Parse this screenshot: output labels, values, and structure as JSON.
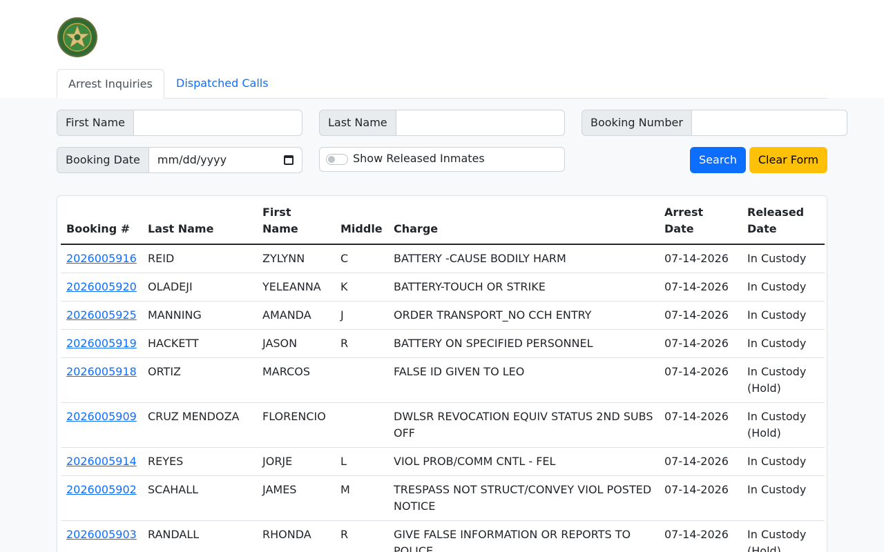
{
  "tabs": [
    {
      "label": "Arrest Inquiries",
      "active": true
    },
    {
      "label": "Dispatched Calls",
      "active": false
    }
  ],
  "form": {
    "first_name_label": "First Name",
    "first_name_value": "",
    "last_name_label": "Last Name",
    "last_name_value": "",
    "booking_number_label": "Booking Number",
    "booking_number_value": "",
    "booking_date_label": "Booking Date",
    "booking_date_placeholder": "mm/dd/yyyy",
    "show_released_label": "Show Released Inmates",
    "show_released_checked": false,
    "search_label": "Search",
    "clear_label": "Clear Form"
  },
  "table": {
    "headers": {
      "booking": "Booking #",
      "last": "Last Name",
      "first_line1": "First",
      "first_line2": "Name",
      "middle": "Middle",
      "charge": "Charge",
      "arrest_line1": "Arrest",
      "arrest_line2": "Date",
      "released_line1": "Released",
      "released_line2": "Date"
    },
    "rows": [
      {
        "booking": "2026005916",
        "last": "REID",
        "first": "ZYLYNN",
        "middle": "C",
        "charge": "BATTERY -CAUSE BODILY HARM",
        "arrest": "07-14-2026",
        "released": "In Custody"
      },
      {
        "booking": "2026005920",
        "last": "OLADEJI",
        "first": "YELEANNA",
        "middle": "K",
        "charge": "BATTERY-TOUCH OR STRIKE",
        "arrest": "07-14-2026",
        "released": "In Custody"
      },
      {
        "booking": "2026005925",
        "last": "MANNING",
        "first": "AMANDA",
        "middle": "J",
        "charge": "ORDER TRANSPORT_NO CCH ENTRY",
        "arrest": "07-14-2026",
        "released": "In Custody"
      },
      {
        "booking": "2026005919",
        "last": "HACKETT",
        "first": "JASON",
        "middle": "R",
        "charge": "BATTERY ON SPECIFIED PERSONNEL",
        "arrest": "07-14-2026",
        "released": "In Custody"
      },
      {
        "booking": "2026005918",
        "last": "ORTIZ",
        "first": "MARCOS",
        "middle": "",
        "charge": "FALSE ID GIVEN TO LEO",
        "arrest": "07-14-2026",
        "released": "In Custody (Hold)"
      },
      {
        "booking": "2026005909",
        "last": "CRUZ MENDOZA",
        "first": "FLORENCIO",
        "middle": "",
        "charge": "DWLSR REVOCATION EQUIV STATUS 2ND SUBS OFF",
        "arrest": "07-14-2026",
        "released": "In Custody (Hold)"
      },
      {
        "booking": "2026005914",
        "last": "REYES",
        "first": "JORJE",
        "middle": "L",
        "charge": "VIOL PROB/COMM CNTL - FEL",
        "arrest": "07-14-2026",
        "released": "In Custody"
      },
      {
        "booking": "2026005902",
        "last": "SCAHALL",
        "first": "JAMES",
        "middle": "M",
        "charge": "TRESPASS NOT STRUCT/CONVEY VIOL POSTED NOTICE",
        "arrest": "07-14-2026",
        "released": "In Custody"
      },
      {
        "booking": "2026005903",
        "last": "RANDALL",
        "first": "RHONDA",
        "middle": "R",
        "charge": "GIVE FALSE INFORMATION OR REPORTS TO POLICE",
        "arrest": "07-14-2026",
        "released": "In Custody (Hold)"
      }
    ]
  },
  "colors": {
    "primary": "#0d6efd",
    "warning": "#ffc107",
    "badge_green": "#1e7a3a",
    "badge_gold": "#c9a640"
  }
}
